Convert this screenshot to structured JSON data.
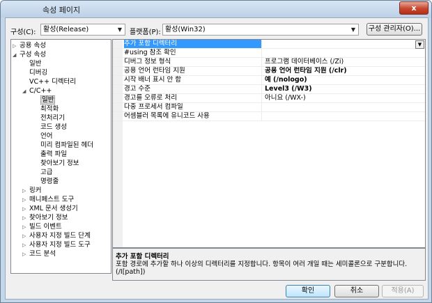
{
  "window": {
    "title": "속성 페이지",
    "close_label": "x"
  },
  "toolbar": {
    "config_label": "구성(C):",
    "config_value": "활성(Release)",
    "platform_label": "플랫폼(P):",
    "platform_value": "활성(Win32)",
    "config_manager_label": "구성 관리자(O)..."
  },
  "tree": {
    "items": [
      {
        "label": "공용 속성"
      },
      {
        "label": "구성 속성"
      },
      {
        "label": "일반"
      },
      {
        "label": "디버깅"
      },
      {
        "label": "VC++ 디렉터리"
      },
      {
        "label": "C/C++"
      },
      {
        "label": "일반"
      },
      {
        "label": "최적화"
      },
      {
        "label": "전처리기"
      },
      {
        "label": "코드 생성"
      },
      {
        "label": "언어"
      },
      {
        "label": "미리 컴파일된 헤더"
      },
      {
        "label": "출력 파일"
      },
      {
        "label": "찾아보기 정보"
      },
      {
        "label": "고급"
      },
      {
        "label": "명령줄"
      },
      {
        "label": "링커"
      },
      {
        "label": "매니페스트 도구"
      },
      {
        "label": "XML 문서 생성기"
      },
      {
        "label": "찾아보기 정보"
      },
      {
        "label": "빌드 이벤트"
      },
      {
        "label": "사용자 지정 빌드 단계"
      },
      {
        "label": "사용자 지정 빌드 도구"
      },
      {
        "label": "코드 분석"
      }
    ]
  },
  "grid": {
    "rows": [
      {
        "name": "추가 포함 디렉터리",
        "value": ""
      },
      {
        "name": "#using 참조 확인",
        "value": ""
      },
      {
        "name": "디버그 정보 형식",
        "value": "프로그램 데이터베이스 (/Zi)"
      },
      {
        "name": "공용 언어 런타임 지원",
        "value": "공용 언어 런타임 지원 (/clr)"
      },
      {
        "name": "시작 배너 표시 안 함",
        "value": "예 (/nologo)"
      },
      {
        "name": "경고 수준",
        "value": "Level3 (/W3)"
      },
      {
        "name": "경고를 오류로 처리",
        "value": "아니요 (/WX-)"
      },
      {
        "name": "다중 프로세서 컴파일",
        "value": ""
      },
      {
        "name": "어셈블러 목록에 유니코드 사용",
        "value": ""
      }
    ]
  },
  "description": {
    "title": "추가 포함 디렉터리",
    "text": "포함 경로에 추가할 하나 이상의 디렉터리를 지정합니다. 항목이 여러 개일 때는 세미콜론으로 구분합니다.",
    "switch": "(/I[path])"
  },
  "buttons": {
    "ok": "확인",
    "cancel": "취소",
    "apply": "적용(A)"
  },
  "colors": {
    "selection": "#3399ff",
    "frame": "#c4d6ea",
    "close": "#c7462e"
  },
  "icons": {
    "expand": "triangle-right",
    "collapse": "triangle-down",
    "dropdown": "chevron-down"
  }
}
